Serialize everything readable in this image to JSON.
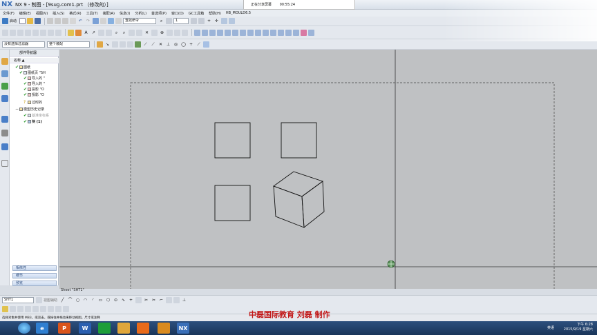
{
  "window": {
    "logo": "NX",
    "title": "NX 9 - 制图 - [9sug.com1.prt （修改的）]"
  },
  "share": {
    "label": "正在分享屏幕",
    "time": "00:55:24"
  },
  "menu": [
    "文件(F)",
    "编辑(E)",
    "视图(V)",
    "插入(S)",
    "格式(R)",
    "工具(T)",
    "装配(A)",
    "信息(I)",
    "分析(L)",
    "首选项(P)",
    "窗口(O)",
    "GC工具箱",
    "帮助(H)",
    "HB_MOULD6.5"
  ],
  "toolbar1": {
    "start_label": "启动",
    "command_search": "查找命令",
    "layer_value": "1"
  },
  "toolbar3": {
    "filter": "没有选择过滤器",
    "scope": "整个装配"
  },
  "navigator": {
    "title": "部件导航器",
    "col_header": "名称",
    "tree": [
      "图纸",
      "图纸页 \"SH",
      "导入的 \"",
      "导入的 \"",
      "投影 \"O",
      "投影 \"O",
      "过时的",
      "模型历史记录",
      "基准坐标系",
      "块 (1)"
    ],
    "panels": [
      "相依性",
      "细节",
      "预览"
    ]
  },
  "canvas": {
    "sheet_label": "Sheet \"SHT1\""
  },
  "bottom_toolbar": {
    "sheet_combo": "SHT1",
    "mode": "视图辅助"
  },
  "status": "选择对象并使用 MB3，或双击，或按住并拖动来移动视图。尺寸或注释",
  "watermark": "中磊国际教育  刘磊  制作",
  "taskbar": {
    "lang": "英语",
    "time": "下午 6:28",
    "date": "2015/9/19 星期六"
  },
  "colors": {
    "canvas": "#bfc1c3",
    "watermark": "#c21818",
    "taskbar": "#1f3d66"
  }
}
